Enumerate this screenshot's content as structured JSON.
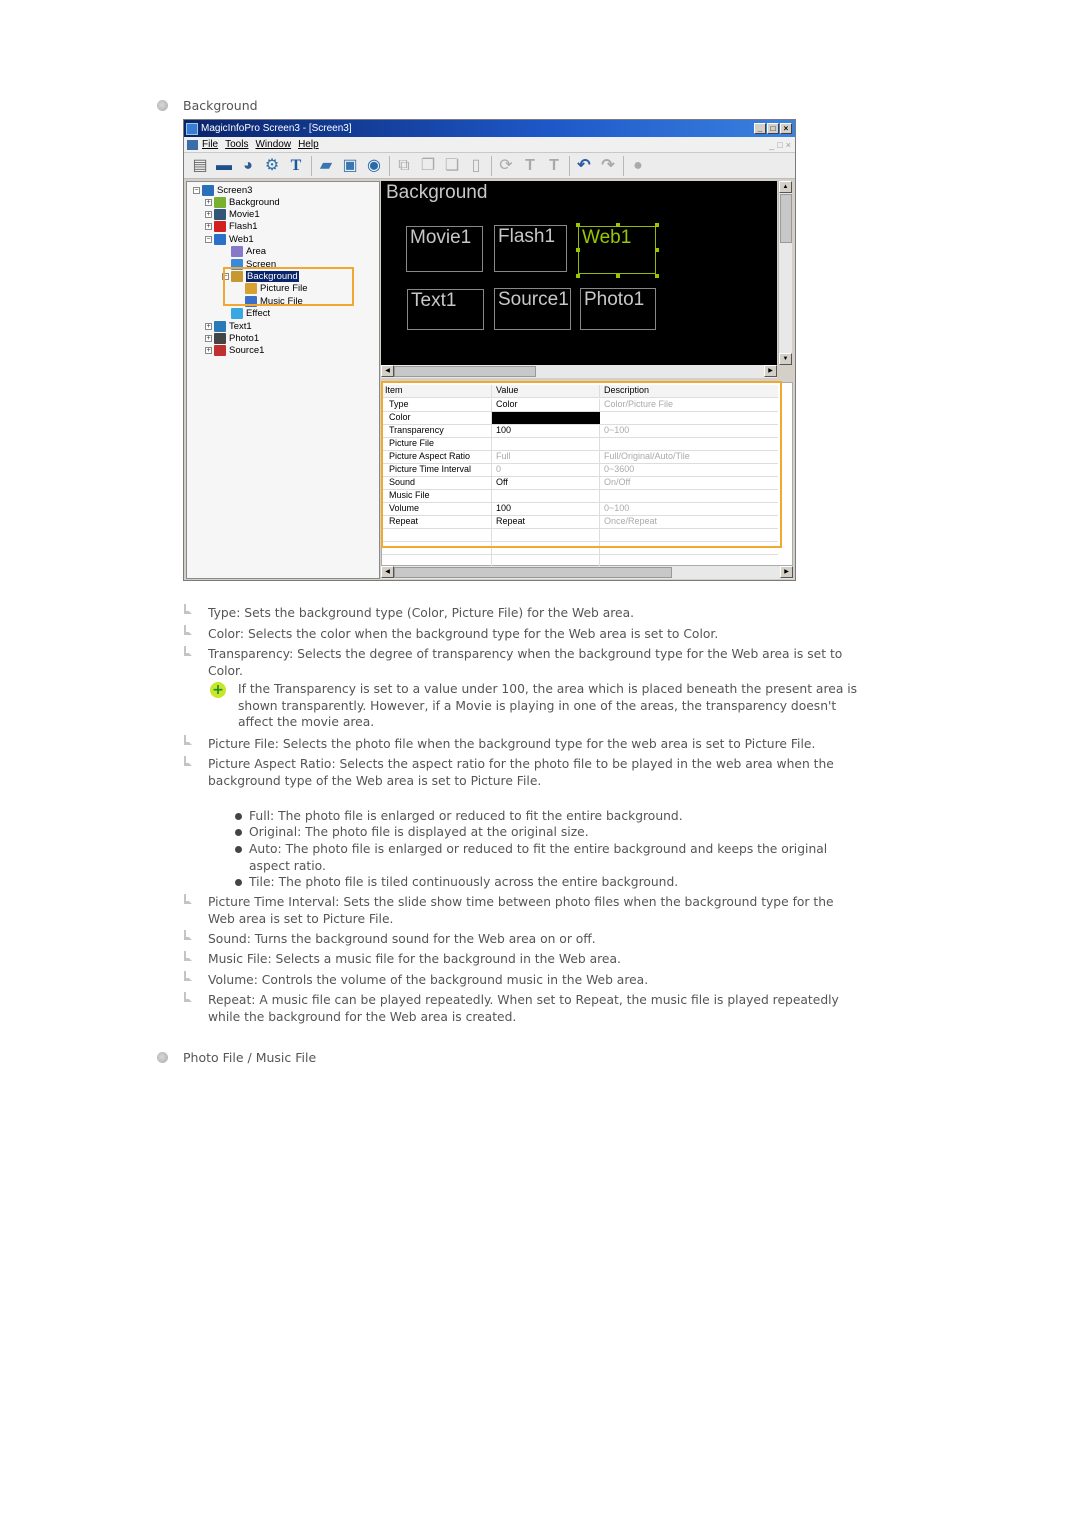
{
  "sections": [
    {
      "heading": "Background"
    },
    {
      "heading": "Photo File / Music File"
    }
  ],
  "window": {
    "title": "MagicInfoPro Screen3 - [Screen3]",
    "caption_buttons": [
      "_",
      "□",
      "×"
    ],
    "mdi_buttons": [
      "_",
      "□",
      "×"
    ],
    "menu": [
      "File",
      "Tools",
      "Window",
      "Help"
    ],
    "toolbar_icons": [
      "new-screen-icon",
      "monitor-icon",
      "schedule-icon",
      "settings-icon",
      "text-icon",
      "open-folder-icon",
      "save-icon",
      "preview-icon",
      "add-area-icon",
      "copy-area-icon",
      "paste-area-icon",
      "delete-icon",
      "refresh-icon",
      "align-text-icon",
      "text-format-icon",
      "undo-icon",
      "redo-icon",
      "info-icon"
    ],
    "tree": {
      "root": "Screen3",
      "nodes": [
        {
          "label": "Background",
          "level": 1,
          "expander": "+"
        },
        {
          "label": "Movie1",
          "level": 1,
          "expander": "+"
        },
        {
          "label": "Flash1",
          "level": 1,
          "expander": "+"
        },
        {
          "label": "Web1",
          "level": 1,
          "expander": "-"
        },
        {
          "label": "Area",
          "level": 2,
          "expander": ""
        },
        {
          "label": "Screen",
          "level": 2,
          "expander": ""
        },
        {
          "label": "Background",
          "level": 2,
          "expander": "-",
          "selected": true
        },
        {
          "label": "Picture File",
          "level": 3,
          "expander": ""
        },
        {
          "label": "Music File",
          "level": 3,
          "expander": ""
        },
        {
          "label": "Effect",
          "level": 2,
          "expander": ""
        },
        {
          "label": "Text1",
          "level": 1,
          "expander": "+"
        },
        {
          "label": "Photo1",
          "level": 1,
          "expander": "+"
        },
        {
          "label": "Source1",
          "level": 1,
          "expander": "+"
        }
      ]
    },
    "canvas": {
      "title": "Background",
      "areas": [
        "Movie1",
        "Flash1",
        "Web1",
        "Text1",
        "Source1",
        "Photo1"
      ],
      "selected_area": "Web1"
    },
    "properties": {
      "headers": [
        "Item",
        "Value",
        "Description"
      ],
      "rows": [
        {
          "item": "Type",
          "value": "Color",
          "description": "Color/Picture File"
        },
        {
          "item": "Color",
          "value": "",
          "description": "",
          "swatch": "#000000"
        },
        {
          "item": "Transparency",
          "value": "100",
          "description": "0~100"
        },
        {
          "item": "Picture File",
          "value": "",
          "description": ""
        },
        {
          "item": "Picture Aspect Ratio",
          "value": "Full",
          "description": "Full/Original/Auto/Tile",
          "disabled": true
        },
        {
          "item": "Picture Time Interval",
          "value": "0",
          "description": "0~3600",
          "disabled": true
        },
        {
          "item": "Sound",
          "value": "Off",
          "description": "On/Off"
        },
        {
          "item": "Music File",
          "value": "",
          "description": ""
        },
        {
          "item": "Volume",
          "value": "100",
          "description": "0~100"
        },
        {
          "item": "Repeat",
          "value": "Repeat",
          "description": "Once/Repeat"
        }
      ]
    }
  },
  "notes": [
    "Type: Sets the background type (Color, Picture File) for the Web area.",
    "Color: Selects the color when the background type for the Web area is set to Color.",
    "Transparency: Selects the degree of transparency when the background type for the Web area is set to Color.",
    "Picture File: Selects the photo file when the background type for the web area is set to Picture File.",
    "Picture Aspect Ratio: Selects the aspect ratio for the photo file to be played in the web area when the background type of the Web area is set to Picture File.",
    "Picture Time Interval: Sets the slide show time between photo files when the background type for the Web area is set to Picture File.",
    "Sound: Turns the background sound for the Web area on or off.",
    "Music File: Selects a music file for the background in the Web area.",
    "Volume: Controls the volume of the background music in the Web area.",
    "Repeat: A music file can be played repeatedly. When set to Repeat, the music file is played repeatedly while the background for the Web area is created."
  ],
  "tip": "If the Transparency is set to a value under 100, the area which is placed beneath the present area is shown transparently. However, if a Movie is playing in one of the areas, the transparency doesn't affect the movie area.",
  "aspect_options": [
    "Full: The photo file is enlarged or reduced to fit the entire background.",
    "Original: The photo file is displayed at the original size.",
    "Auto: The photo file is enlarged or reduced to fit the entire background and keeps the original aspect ratio.",
    "Tile: The photo file is tiled continuously across the entire background."
  ]
}
